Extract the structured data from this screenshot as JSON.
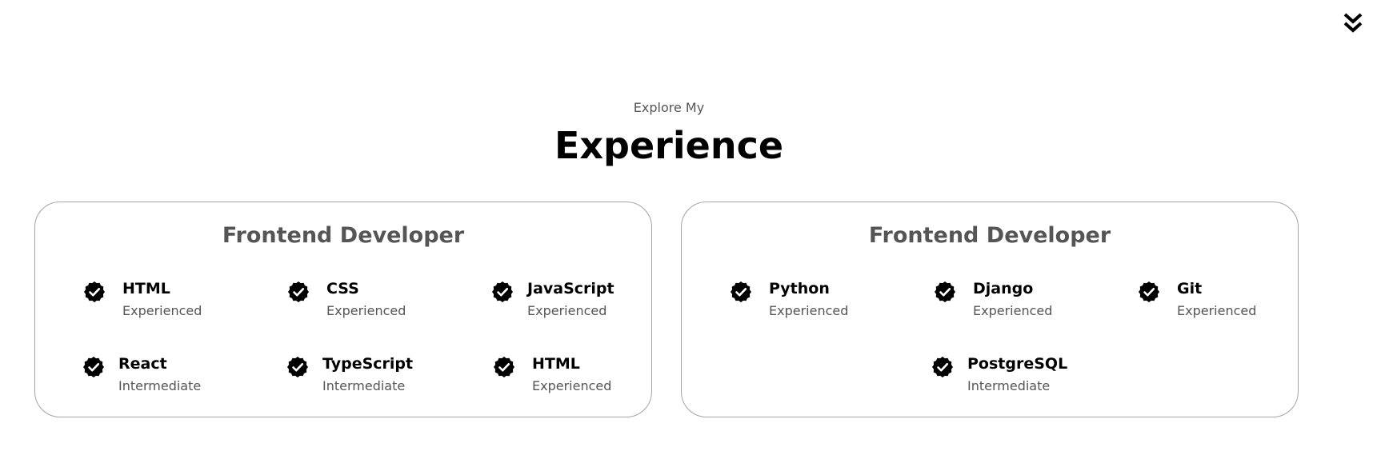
{
  "header": {
    "subtitle": "Explore My",
    "title": "Experience"
  },
  "icons": {
    "scroll": "double-chevron-down-icon",
    "check": "check-badge-icon"
  },
  "cards": [
    {
      "title": "Frontend Developer",
      "skills": [
        {
          "name": "HTML",
          "level": "Experienced"
        },
        {
          "name": "CSS",
          "level": "Experienced"
        },
        {
          "name": "JavaScript",
          "level": "Experienced"
        },
        {
          "name": "React",
          "level": "Intermediate"
        },
        {
          "name": "TypeScript",
          "level": "Intermediate"
        },
        {
          "name": "HTML",
          "level": "Experienced"
        }
      ]
    },
    {
      "title": "Frontend Developer",
      "skills": [
        {
          "name": "Python",
          "level": "Experienced"
        },
        {
          "name": "Django",
          "level": "Experienced"
        },
        {
          "name": "Git",
          "level": "Experienced"
        },
        {
          "name": "PostgreSQL",
          "level": "Intermediate"
        }
      ]
    }
  ]
}
